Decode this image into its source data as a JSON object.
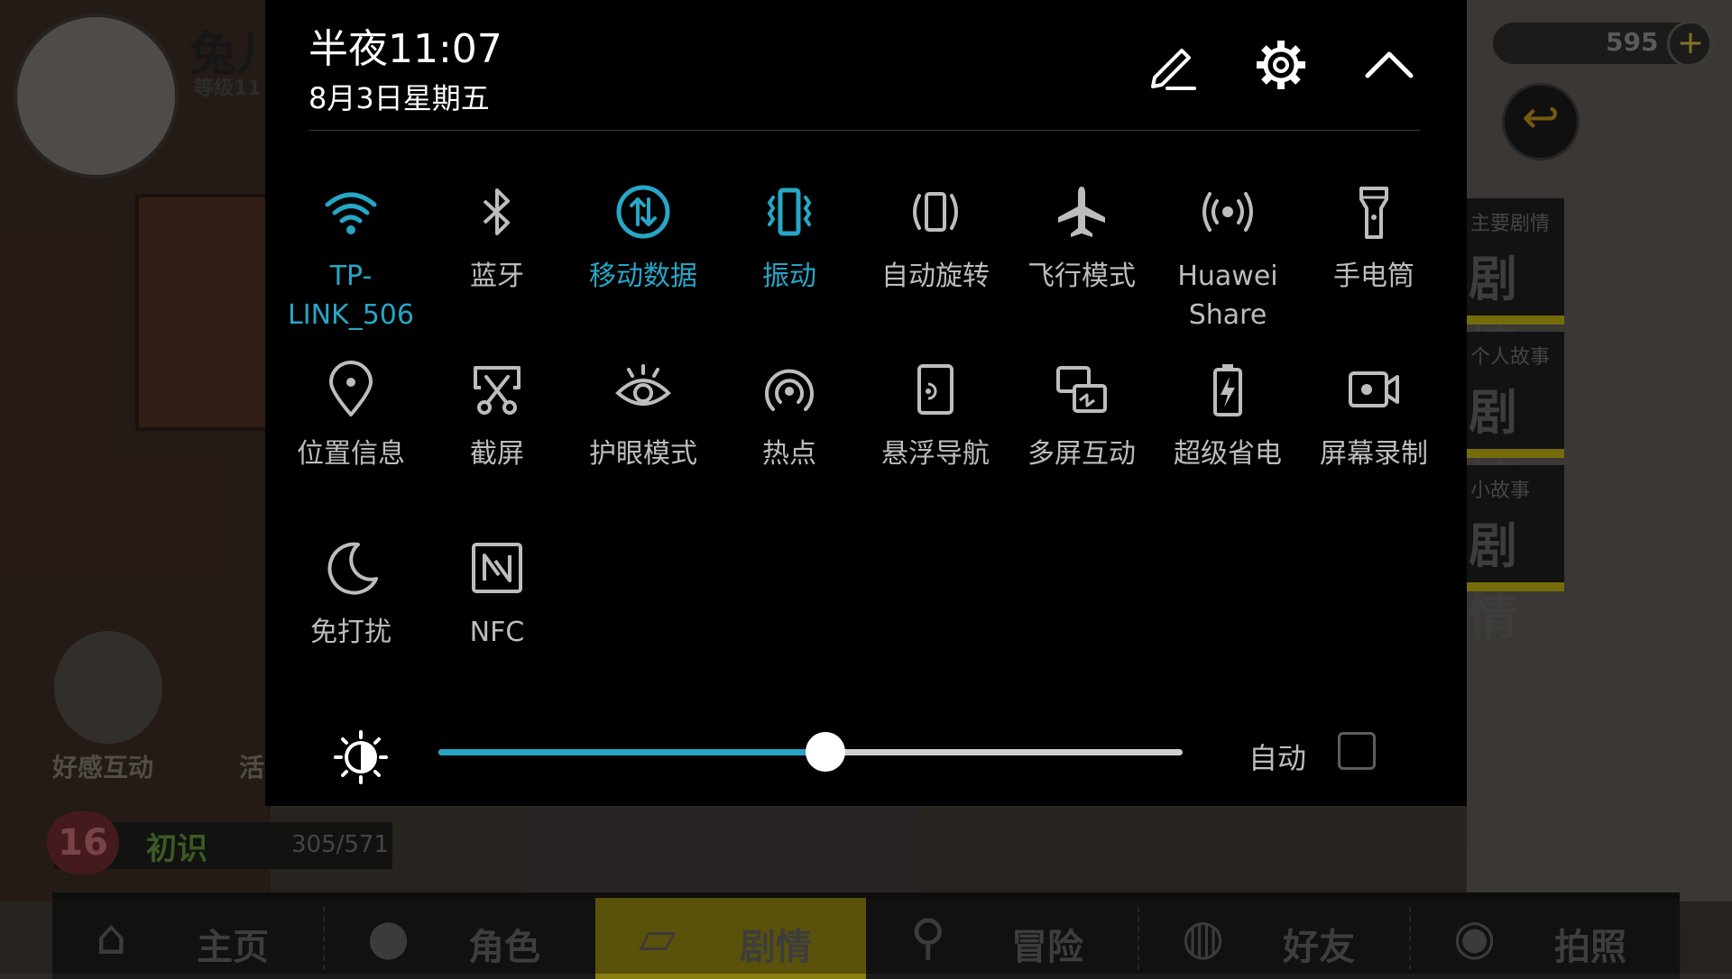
{
  "status": {
    "time": "半夜11:07",
    "date": "8月3日星期五"
  },
  "header_icons": [
    "edit-icon",
    "settings-gear-icon",
    "collapse-chevron-up-icon"
  ],
  "tiles": [
    {
      "label": "TP-LINK_506",
      "icon": "wifi-icon",
      "active": true
    },
    {
      "label": "蓝牙",
      "icon": "bluetooth-icon",
      "active": false
    },
    {
      "label": "移动数据",
      "icon": "mobile-data-icon",
      "active": true
    },
    {
      "label": "振动",
      "icon": "vibrate-icon",
      "active": true
    },
    {
      "label": "自动旋转",
      "icon": "auto-rotate-icon",
      "active": false
    },
    {
      "label": "飞行模式",
      "icon": "airplane-icon",
      "active": false
    },
    {
      "label": "Huawei Share",
      "icon": "huawei-share-icon",
      "active": false
    },
    {
      "label": "手电筒",
      "icon": "flashlight-icon",
      "active": false
    },
    {
      "label": "位置信息",
      "icon": "location-pin-icon",
      "active": false
    },
    {
      "label": "截屏",
      "icon": "screenshot-scissors-icon",
      "active": false
    },
    {
      "label": "护眼模式",
      "icon": "eye-icon",
      "active": false
    },
    {
      "label": "热点",
      "icon": "hotspot-icon",
      "active": false
    },
    {
      "label": "悬浮导航",
      "icon": "floating-nav-icon",
      "active": false
    },
    {
      "label": "多屏互动",
      "icon": "multi-screen-icon",
      "active": false
    },
    {
      "label": "超级省电",
      "icon": "battery-saver-icon",
      "active": false
    },
    {
      "label": "屏幕录制",
      "icon": "screen-record-icon",
      "active": false
    },
    {
      "label": "免打扰",
      "icon": "moon-icon",
      "active": false
    },
    {
      "label": "NFC",
      "icon": "nfc-icon",
      "active": false
    }
  ],
  "brightness": {
    "level": 0.52,
    "auto_label": "自动",
    "auto_checked": false,
    "icon": "brightness-sun-icon"
  },
  "accent_color": "#27a6c6",
  "background_game": {
    "player_name": "兔儿",
    "level_text": "等级11",
    "currency": "595",
    "story_tabs": [
      {
        "sub": "主要剧情",
        "main": "剧情"
      },
      {
        "sub": "个人故事",
        "main": "剧情"
      },
      {
        "sub": "小故事",
        "main": "剧情"
      }
    ],
    "favor_label": "好感互动",
    "activity_label": "活",
    "intimacy": {
      "level": "16",
      "label": "初识",
      "value": "305/571"
    },
    "nav": [
      {
        "label": "主页",
        "icon": "home-icon"
      },
      {
        "label": "角色",
        "icon": "characters-icon"
      },
      {
        "label": "剧情",
        "icon": "story-cards-icon",
        "active": true
      },
      {
        "label": "冒险",
        "icon": "map-pin-icon"
      },
      {
        "label": "好友",
        "icon": "chat-bubbles-icon"
      },
      {
        "label": "拍照",
        "icon": "camera-icon"
      }
    ]
  }
}
